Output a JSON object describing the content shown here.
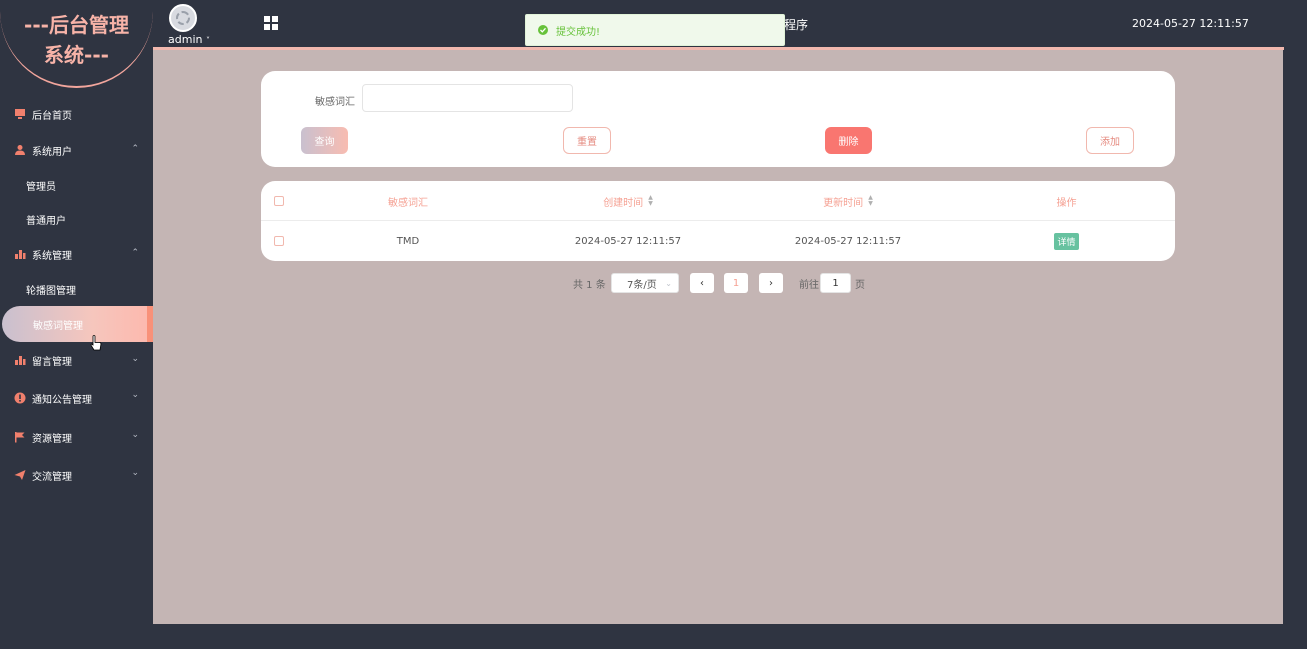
{
  "sidebar": {
    "logo_line1": "---后台管理",
    "logo_line2": "系统---",
    "items": [
      {
        "label": "后台首页"
      },
      {
        "label": "系统用户",
        "children": [
          "管理员",
          "普通用户"
        ]
      },
      {
        "label": "系统管理",
        "children": [
          "轮播图管理",
          "敏感词管理"
        ]
      },
      {
        "label": "留言管理"
      },
      {
        "label": "通知公告管理"
      },
      {
        "label": "资源管理"
      },
      {
        "label": "交流管理"
      }
    ]
  },
  "header": {
    "username": "admin",
    "title_fragment": "程序",
    "datetime": "2024-05-27 12:11:57"
  },
  "toast": {
    "message": "提交成功!",
    "color": "#67c23a"
  },
  "search": {
    "label": "敏感词汇",
    "value": "",
    "query_label": "查询",
    "reset_label": "重置",
    "delete_label": "删除",
    "add_label": "添加"
  },
  "table": {
    "columns": [
      "敏感词汇",
      "创建时间",
      "更新时间",
      "操作"
    ],
    "rows": [
      {
        "word": "TMD",
        "created": "2024-05-27 12:11:57",
        "updated": "2024-05-27 12:11:57",
        "action": "详情"
      }
    ]
  },
  "pagination": {
    "total": "共 1 条",
    "page_size": "7条/页",
    "current_page": "1",
    "goto_label": "前往",
    "goto_value": "1",
    "page_suffix": "页"
  },
  "colors": {
    "sidebar_bg": "#2f3441",
    "main_bg": "#c4b5b4",
    "accent": "#f5a193",
    "delete": "#f97670",
    "detail": "#67c2a0"
  }
}
